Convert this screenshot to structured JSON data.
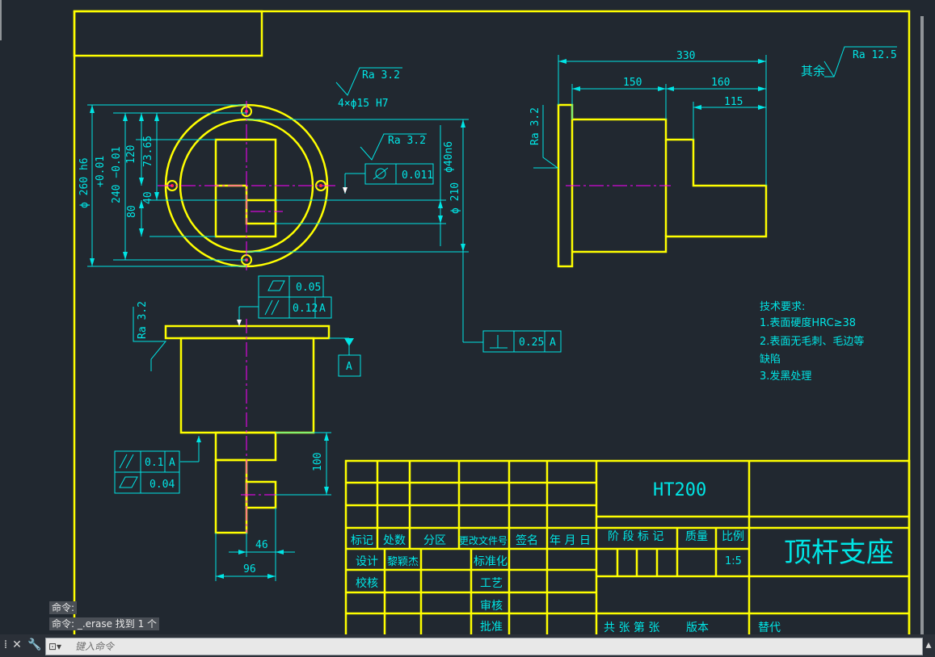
{
  "drawing": {
    "annotations": {
      "ra_top": "Ra  3.2",
      "holes": "4×ϕ15 H7",
      "ra_mid": "Ra  3.2",
      "flatness_top": "0.011",
      "ra_side_left": "Ra 3.2",
      "ra_side_right": "Ra 3.2",
      "ra_other_label": "其余",
      "ra_other": "Ra  12.5",
      "ftol_flat": "0.05",
      "ftol_par": "0.12",
      "ftol_par_ref": "A",
      "datum_a": "A",
      "ftol_perp": "0.25",
      "ftol_perp_ref": "A",
      "ftol_par2": "0.1",
      "ftol_par2_ref": "A",
      "ftol_flat2": "0.04"
    },
    "dimensions": {
      "d260": "ϕ 260 h6",
      "tol_plus": "+0.01",
      "d240": "240 −0.01",
      "d120": "120",
      "d7365": "73.65",
      "d40": "40",
      "d80": "80",
      "d40n6": "ϕ40n6",
      "d210": "ϕ 210",
      "d330": "330",
      "d150": "150",
      "d160": "160",
      "d115": "115",
      "d100": "100",
      "d46": "46",
      "d96": "96"
    },
    "notes": {
      "title": "技术要求:",
      "line1": "1.表面硬度HRC≥38",
      "line2": "2.表面无毛刺、毛边等",
      "line3": "缺陷",
      "line4": "3.发黑处理"
    },
    "title_block": {
      "material": "HT200",
      "part_name": "顶杆支座",
      "hdr_mark": "标记",
      "hdr_count": "处数",
      "hdr_zone": "分区",
      "hdr_doc": "更改文件号",
      "hdr_sign": "签名",
      "hdr_date": "年 月 日",
      "stage_mark": "阶 段 标 记",
      "mass": "质量",
      "scale_label": "比例",
      "scale_value": "1:5",
      "design": "设计",
      "designer": "黎颖杰",
      "standardize": "标准化",
      "check": "校核",
      "process": "工艺",
      "review": "审核",
      "approve": "批准",
      "sheets": "共  张 第  张",
      "version": "版本",
      "replace": "替代"
    }
  },
  "command": {
    "history": [
      "命令:",
      "命令: _.erase 找到 1 个"
    ],
    "placeholder": "键入命令"
  },
  "colors": {
    "background": "#212830",
    "outline": "#ffff00",
    "dimension": "#00e5e5",
    "centerline": "#ff00ff",
    "white": "#ffffff"
  }
}
